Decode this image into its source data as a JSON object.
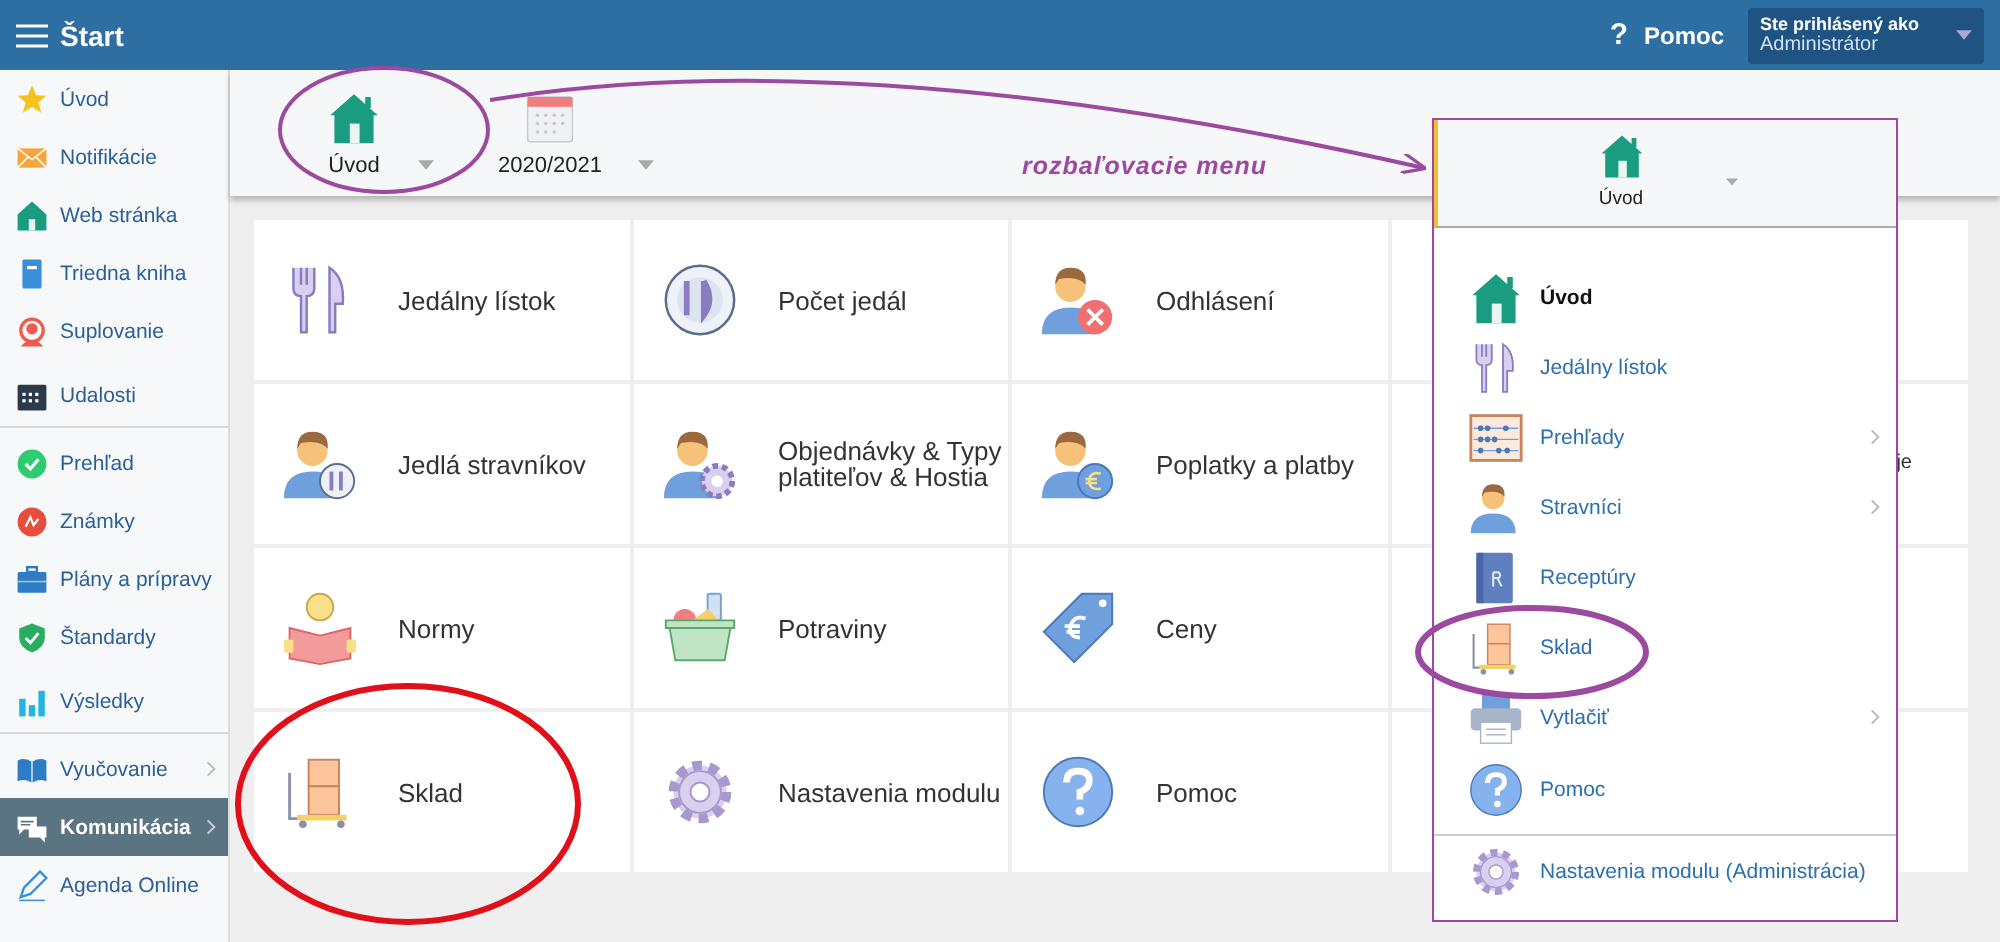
{
  "header": {
    "title": "Štart",
    "help_icon": "?",
    "help_label": "Pomoc",
    "user_caption": "Ste prihlásený ako",
    "user_role": "Administrátor"
  },
  "sidebar": {
    "items": [
      {
        "label": "Úvod",
        "selected": false,
        "has_submenu": false
      },
      {
        "label": "Notifikácie",
        "selected": false,
        "has_submenu": false
      },
      {
        "label": "Web stránka",
        "selected": false,
        "has_submenu": false
      },
      {
        "label": "Triedna kniha",
        "selected": false,
        "has_submenu": false
      },
      {
        "label": "Suplovanie",
        "selected": false,
        "has_submenu": false
      },
      {
        "label": "Udalosti",
        "selected": false,
        "has_submenu": false,
        "divider_after": true
      },
      {
        "label": "Prehľad",
        "selected": false,
        "has_submenu": false
      },
      {
        "label": "Známky",
        "selected": false,
        "has_submenu": false
      },
      {
        "label": "Plány a prípravy",
        "selected": false,
        "has_submenu": false
      },
      {
        "label": "Štandardy",
        "selected": false,
        "has_submenu": false
      },
      {
        "label": "Výsledky",
        "selected": false,
        "has_submenu": false,
        "divider_after": true
      },
      {
        "label": "Vyučovanie",
        "selected": false,
        "has_submenu": true
      },
      {
        "label": "Komunikácia",
        "selected": true,
        "has_submenu": true
      },
      {
        "label": "Agenda Online",
        "selected": false,
        "has_submenu": false
      }
    ]
  },
  "toolbar": {
    "buttons": [
      {
        "label": "Úvod"
      },
      {
        "label": "2020/2021"
      }
    ]
  },
  "tiles": [
    {
      "kind": "module",
      "label": "Jedálny lístok"
    },
    {
      "kind": "module",
      "label": "Počet jedál"
    },
    {
      "kind": "module",
      "label": "Odhlásení"
    },
    {
      "kind": "blank"
    },
    {
      "kind": "module",
      "label": "Jedlá stravníkov"
    },
    {
      "kind": "module",
      "label": "Objednávky & Typy platiteľov & Hostia"
    },
    {
      "kind": "module",
      "label": "Poplatky a platby"
    },
    {
      "kind": "blank",
      "label": "je"
    },
    {
      "kind": "module",
      "label": "Normy"
    },
    {
      "kind": "module",
      "label": "Potraviny"
    },
    {
      "kind": "module",
      "label": "Ceny"
    },
    {
      "kind": "blank"
    },
    {
      "kind": "module",
      "label": "Sklad"
    },
    {
      "kind": "module",
      "label": "Nastavenia modulu"
    },
    {
      "kind": "module",
      "label": "Pomoc"
    },
    {
      "kind": "blank"
    }
  ],
  "dropdown": {
    "label": "Úvod",
    "items": [
      {
        "label": "Úvod",
        "selected": true,
        "has_submenu": false
      },
      {
        "label": "Jedálny lístok",
        "selected": false,
        "has_submenu": false
      },
      {
        "label": "Prehľady",
        "selected": false,
        "has_submenu": true
      },
      {
        "label": "Stravníci",
        "selected": false,
        "has_submenu": true
      },
      {
        "label": "Receptúry",
        "selected": false,
        "has_submenu": false
      },
      {
        "label": "Sklad",
        "selected": false,
        "has_submenu": false
      },
      {
        "label": "Vytlačiť",
        "selected": false,
        "has_submenu": true
      },
      {
        "label": "Pomoc",
        "selected": false,
        "has_submenu": false,
        "divider_after": true
      },
      {
        "label": "Nastavenia modulu (Administrácia)",
        "selected": false,
        "has_submenu": false
      }
    ]
  },
  "annotation": {
    "text": "rozbaľovacie menu"
  }
}
